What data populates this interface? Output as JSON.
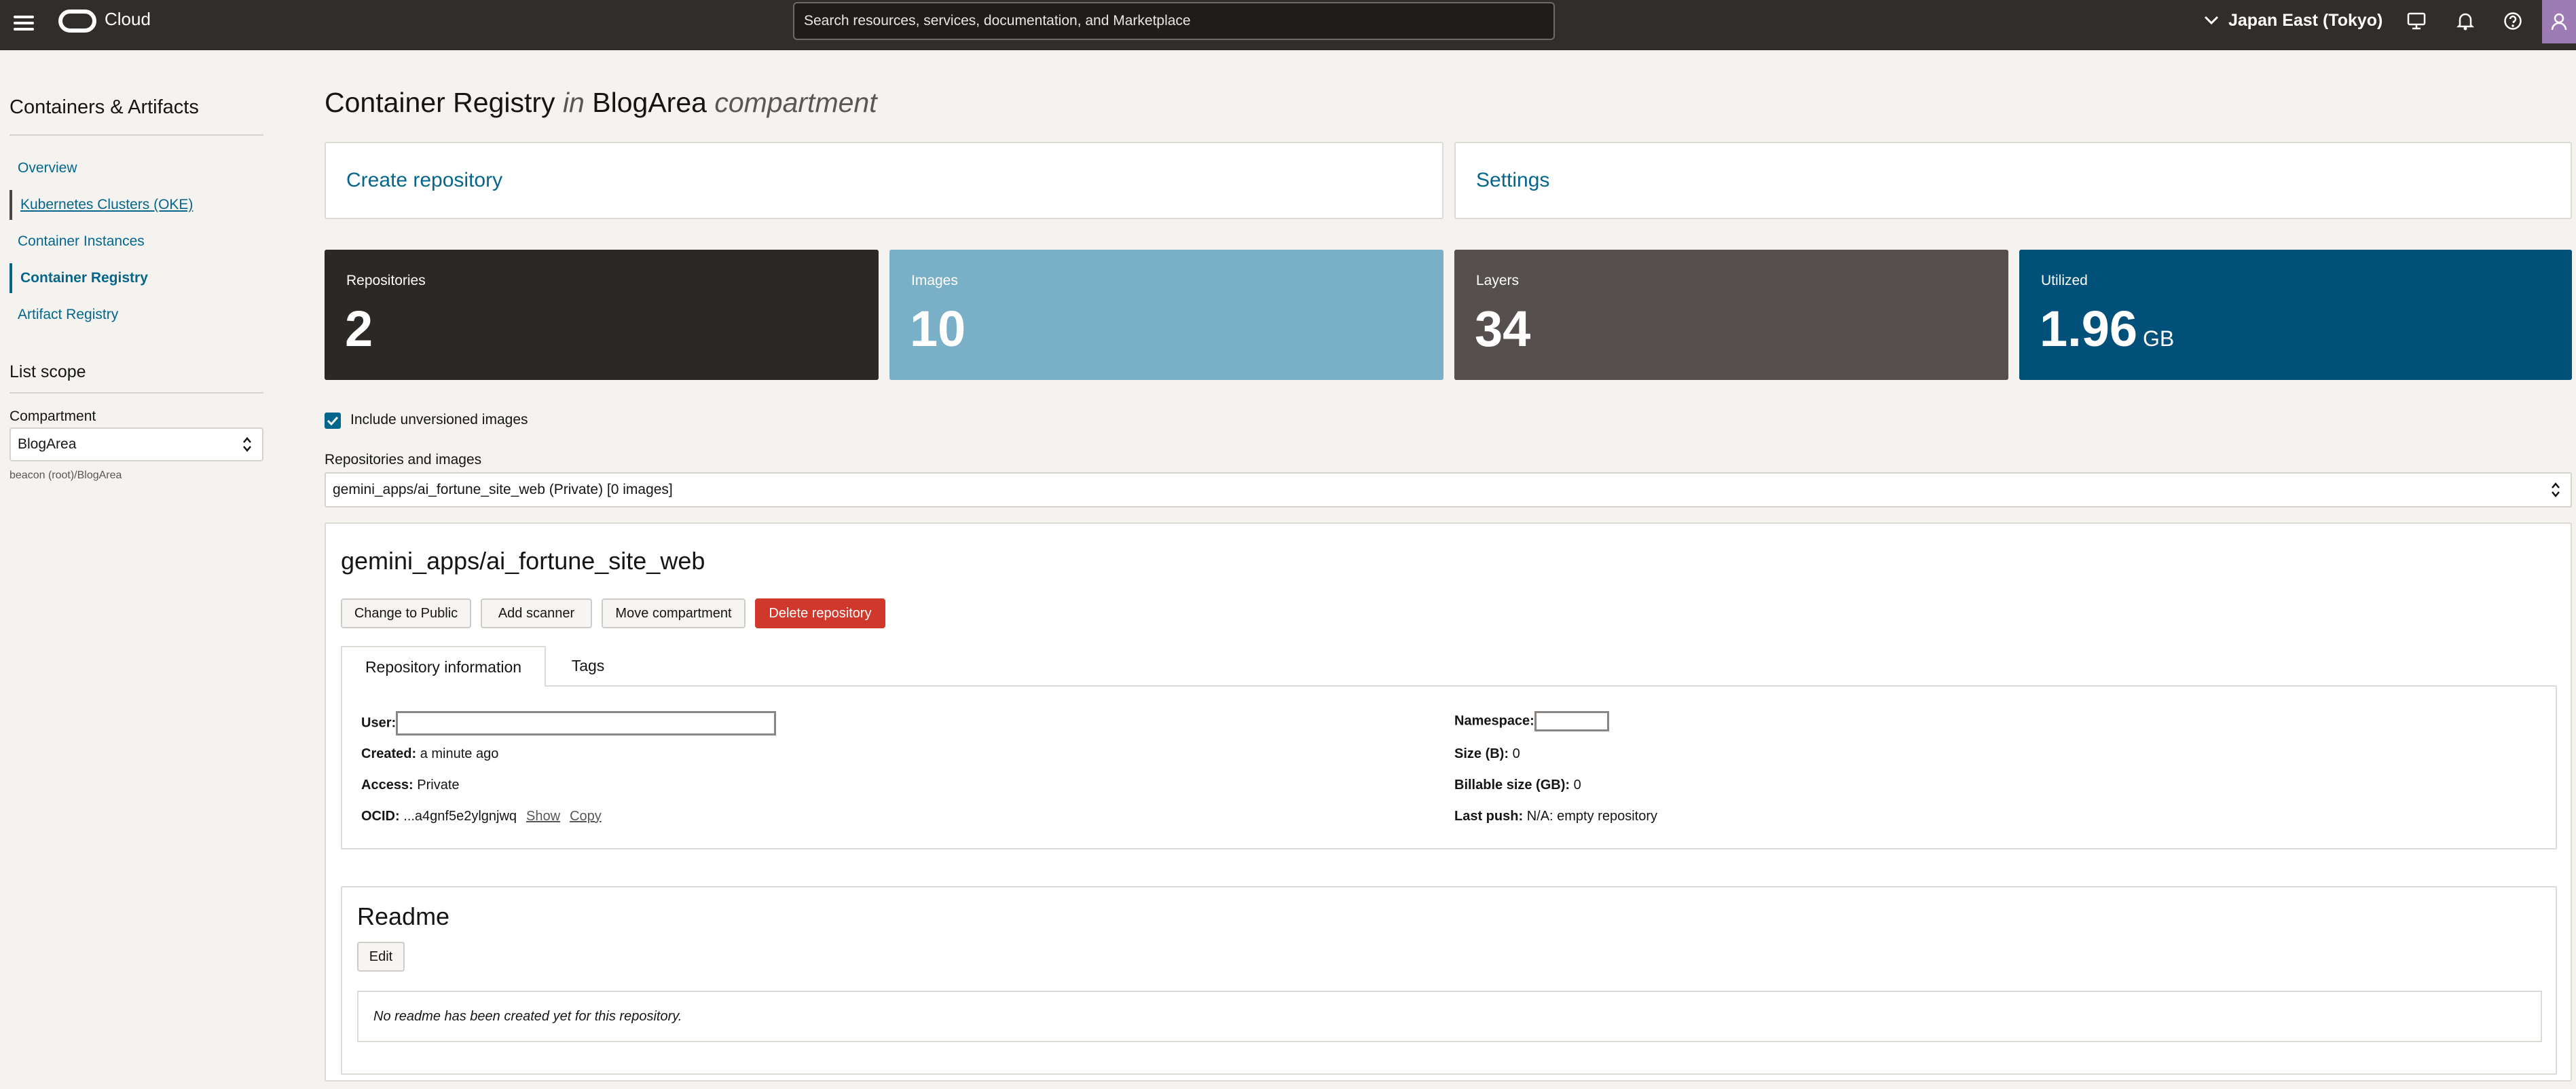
{
  "header": {
    "brand": "Cloud",
    "search_placeholder": "Search resources, services, documentation, and Marketplace",
    "region": "Japan East (Tokyo)",
    "icons": [
      "menu-icon",
      "oracle-logo",
      "chevron-down-icon",
      "console-icon",
      "bell-icon",
      "help-icon",
      "user-icon"
    ]
  },
  "sidebar": {
    "title": "Containers & Artifacts",
    "items": [
      {
        "label": "Overview"
      },
      {
        "label": "Kubernetes Clusters (OKE)"
      },
      {
        "label": "Container Instances"
      },
      {
        "label": "Container Registry"
      },
      {
        "label": "Artifact Registry"
      }
    ],
    "scope_title": "List scope",
    "compartment_label": "Compartment",
    "compartment_value": "BlogArea",
    "compartment_path": "beacon (root)/BlogArea"
  },
  "page": {
    "title_main": "Container Registry",
    "title_in": "in",
    "title_compartment": "BlogArea",
    "title_suffix": "compartment",
    "create_repository": "Create repository",
    "settings": "Settings"
  },
  "metrics": [
    {
      "label": "Repositories",
      "value": "2",
      "unit": "",
      "color": "#2b2825"
    },
    {
      "label": "Images",
      "value": "10",
      "unit": "",
      "color": "#79b0c8"
    },
    {
      "label": "Layers",
      "value": "34",
      "unit": "",
      "color": "#55504d"
    },
    {
      "label": "Utilized",
      "value": "1.96",
      "unit": "GB",
      "color": "#00507a"
    }
  ],
  "filters": {
    "include_unversioned_label": "Include unversioned images",
    "include_unversioned_checked": true,
    "repos_label": "Repositories and images",
    "repos_selected": "gemini_apps/ai_fortune_site_web (Private) [0 images]"
  },
  "repo": {
    "name": "gemini_apps/ai_fortune_site_web",
    "buttons": {
      "change_public": "Change to Public",
      "add_scanner": "Add scanner",
      "move_compartment": "Move compartment",
      "delete_repository": "Delete repository"
    },
    "tabs": {
      "info": "Repository information",
      "tags": "Tags"
    },
    "fields": {
      "user_label": "User:",
      "created_label": "Created:",
      "created_value": "a minute ago",
      "access_label": "Access:",
      "access_value": "Private",
      "ocid_label": "OCID:",
      "ocid_value": "...a4gnf5e2ylgnjwq",
      "show": "Show",
      "copy": "Copy",
      "namespace_label": "Namespace:",
      "size_label": "Size (B):",
      "size_value": "0",
      "billable_label": "Billable size (GB):",
      "billable_value": "0",
      "last_push_label": "Last push:",
      "last_push_value": "N/A: empty repository"
    },
    "readme": {
      "title": "Readme",
      "edit": "Edit",
      "empty": "No readme has been created yet for this repository."
    }
  }
}
